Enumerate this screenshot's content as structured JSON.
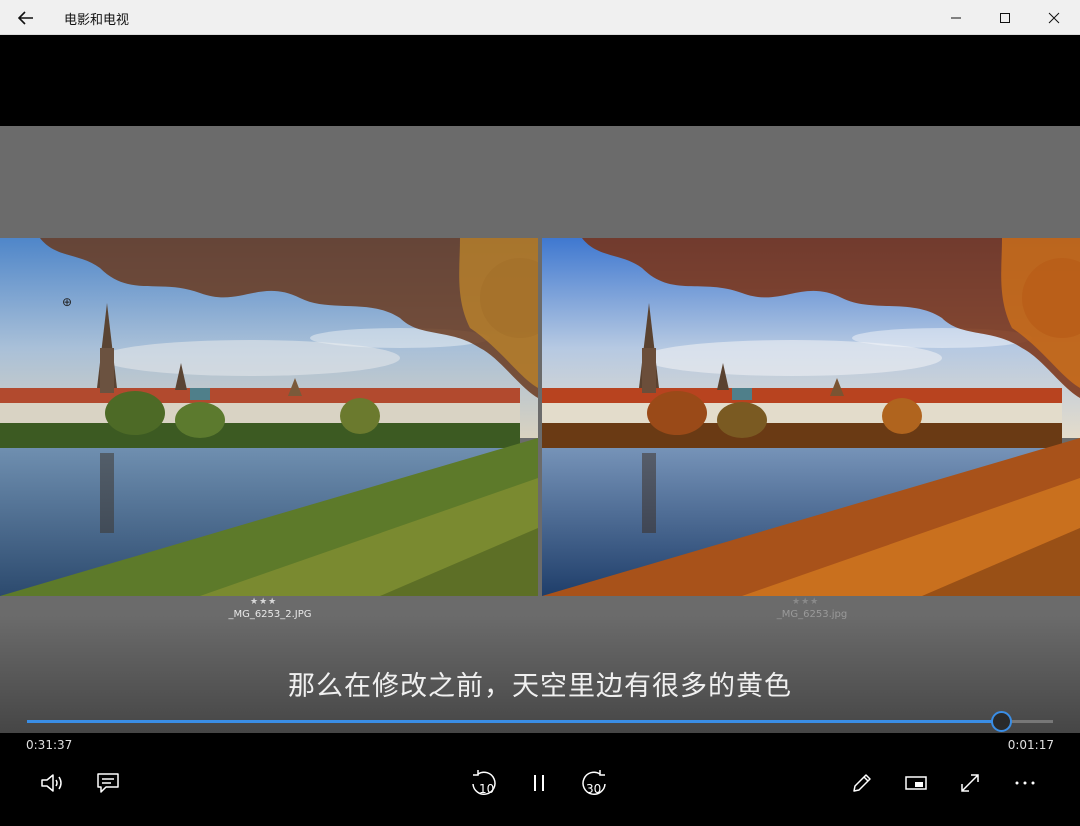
{
  "app": {
    "title": "电影和电视"
  },
  "video": {
    "subtitle": "那么在修改之前，天空里边有很多的黄色",
    "left_photo": {
      "filename": "_MG_6253_2.JPG",
      "stars": "★★★"
    },
    "right_photo": {
      "filename": "_MG_6253.jpg",
      "stars": "★★★"
    }
  },
  "playback": {
    "elapsed": "0:31:37",
    "remaining": "0:01:17",
    "progress_fraction": 0.949,
    "skip_back_seconds": "10",
    "skip_forward_seconds": "30"
  },
  "colors": {
    "accent": "#3a8ee6",
    "frame_bg": "#6b6b6b",
    "titlebar_bg": "#f0f0f0"
  },
  "icons": {
    "back": "arrow-left-icon",
    "volume": "volume-icon",
    "captions": "captions-icon",
    "skip_back": "skip-back-10-icon",
    "pause": "pause-icon",
    "skip_forward": "skip-forward-30-icon",
    "edit": "pencil-icon",
    "mini_view": "mini-view-icon",
    "fullscreen": "fullscreen-icon",
    "more": "more-icon"
  }
}
